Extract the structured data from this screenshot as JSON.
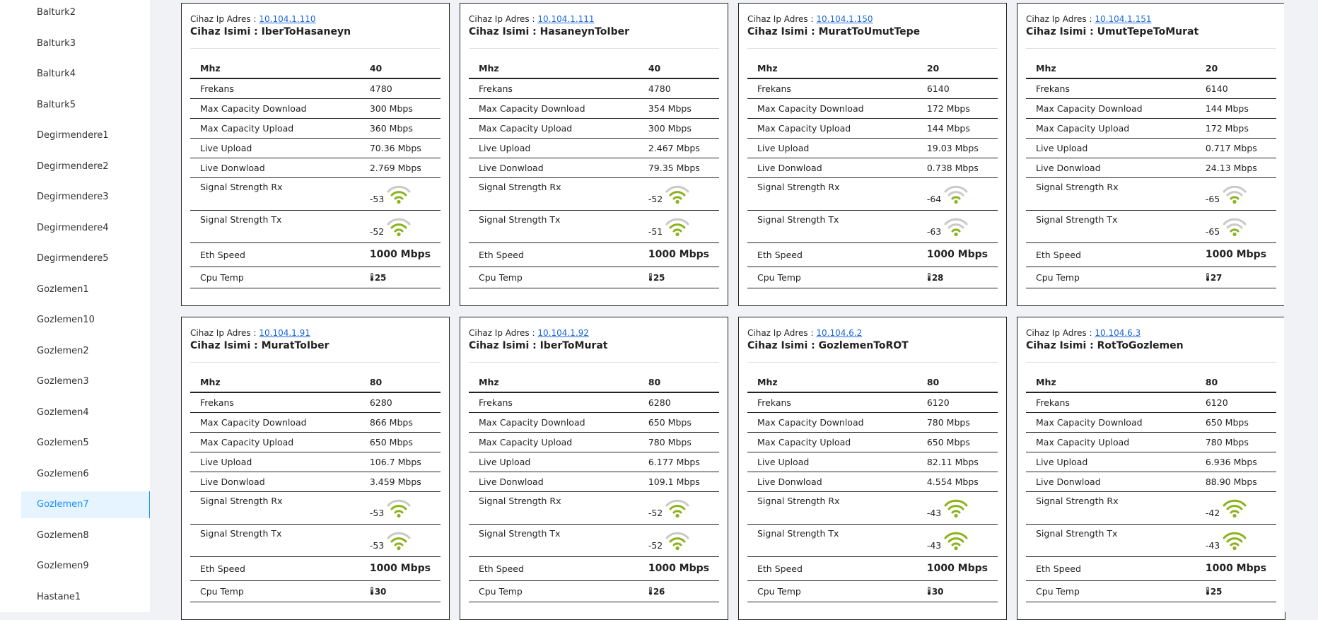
{
  "colors": {
    "accent": "#1890ff",
    "signal_active": "#8bb31c",
    "signal_inactive": "#c9c9c9",
    "link": "#1a66d9"
  },
  "sidebar": {
    "active": "Gozlemen7",
    "items": [
      "Balturk2",
      "Balturk3",
      "Balturk4",
      "Balturk5",
      "Degirmendere1",
      "Degirmendere2",
      "Degirmendere3",
      "Degirmendere4",
      "Degirmendere5",
      "Gozlemen1",
      "Gozlemen10",
      "Gozlemen2",
      "Gozlemen3",
      "Gozlemen4",
      "Gozlemen5",
      "Gozlemen6",
      "Gozlemen7",
      "Gozlemen8",
      "Gozlemen9",
      "Hastane1"
    ]
  },
  "labels": {
    "ip_prefix": "Cihaz Ip Adres :",
    "name_prefix": "Cihaz Isimi :",
    "mhz": "Mhz",
    "frekans": "Frekans",
    "max_down": "Max Capacity Download",
    "max_up": "Max Capacity Upload",
    "live_up": "Live Upload",
    "live_down": "Live Donwload",
    "sig_rx": "Signal Strength Rx",
    "sig_tx": "Signal Strength Tx",
    "eth": "Eth Speed",
    "cpu": "Cpu Temp"
  },
  "devices": [
    {
      "ip": "10.104.1.110",
      "name": "IberToHasaneyn",
      "mhz": "40",
      "frekans": "4780",
      "max_down": "300 Mbps",
      "max_up": "360 Mbps",
      "live_up": "70.36 Mbps",
      "live_down": "2.769 Mbps",
      "rx": "-53",
      "rx_bars": 3,
      "tx": "-52",
      "tx_bars": 3,
      "eth": "1000 Mbps",
      "cpu": "25"
    },
    {
      "ip": "10.104.1.111",
      "name": "HasaneynToIber",
      "mhz": "40",
      "frekans": "4780",
      "max_down": "354 Mbps",
      "max_up": "300 Mbps",
      "live_up": "2.467 Mbps",
      "live_down": "79.35 Mbps",
      "rx": "-52",
      "rx_bars": 3,
      "tx": "-51",
      "tx_bars": 3,
      "eth": "1000 Mbps",
      "cpu": "25"
    },
    {
      "ip": "10.104.1.150",
      "name": "MuratToUmutTepe",
      "mhz": "20",
      "frekans": "6140",
      "max_down": "172 Mbps",
      "max_up": "144 Mbps",
      "live_up": "19.03 Mbps",
      "live_down": "0.738 Mbps",
      "rx": "-64",
      "rx_bars": 2,
      "tx": "-63",
      "tx_bars": 2,
      "eth": "1000 Mbps",
      "cpu": "28"
    },
    {
      "ip": "10.104.1.151",
      "name": "UmutTepeToMurat",
      "mhz": "20",
      "frekans": "6140",
      "max_down": "144 Mbps",
      "max_up": "172 Mbps",
      "live_up": "0.717 Mbps",
      "live_down": "24.13 Mbps",
      "rx": "-65",
      "rx_bars": 2,
      "tx": "-65",
      "tx_bars": 2,
      "eth": "1000 Mbps",
      "cpu": "27"
    },
    {
      "ip": "10.104.1.91",
      "name": "MuratToIber",
      "mhz": "80",
      "frekans": "6280",
      "max_down": "866 Mbps",
      "max_up": "650 Mbps",
      "live_up": "106.7 Mbps",
      "live_down": "3.459 Mbps",
      "rx": "-53",
      "rx_bars": 3,
      "tx": "-53",
      "tx_bars": 3,
      "eth": "1000 Mbps",
      "cpu": "30"
    },
    {
      "ip": "10.104.1.92",
      "name": "IberToMurat",
      "mhz": "80",
      "frekans": "6280",
      "max_down": "650 Mbps",
      "max_up": "780 Mbps",
      "live_up": "6.177 Mbps",
      "live_down": "109.1 Mbps",
      "rx": "-52",
      "rx_bars": 3,
      "tx": "-52",
      "tx_bars": 3,
      "eth": "1000 Mbps",
      "cpu": "26"
    },
    {
      "ip": "10.104.6.2",
      "name": "GozlemenToROT",
      "mhz": "80",
      "frekans": "6120",
      "max_down": "780 Mbps",
      "max_up": "650 Mbps",
      "live_up": "82.11 Mbps",
      "live_down": "4.554 Mbps",
      "rx": "-43",
      "rx_bars": 4,
      "tx": "-43",
      "tx_bars": 4,
      "eth": "1000 Mbps",
      "cpu": "30"
    },
    {
      "ip": "10.104.6.3",
      "name": "RotToGozlemen",
      "mhz": "80",
      "frekans": "6120",
      "max_down": "650 Mbps",
      "max_up": "780 Mbps",
      "live_up": "6.936 Mbps",
      "live_down": "88.90 Mbps",
      "rx": "-42",
      "rx_bars": 4,
      "tx": "-43",
      "tx_bars": 4,
      "eth": "1000 Mbps",
      "cpu": "25"
    }
  ]
}
